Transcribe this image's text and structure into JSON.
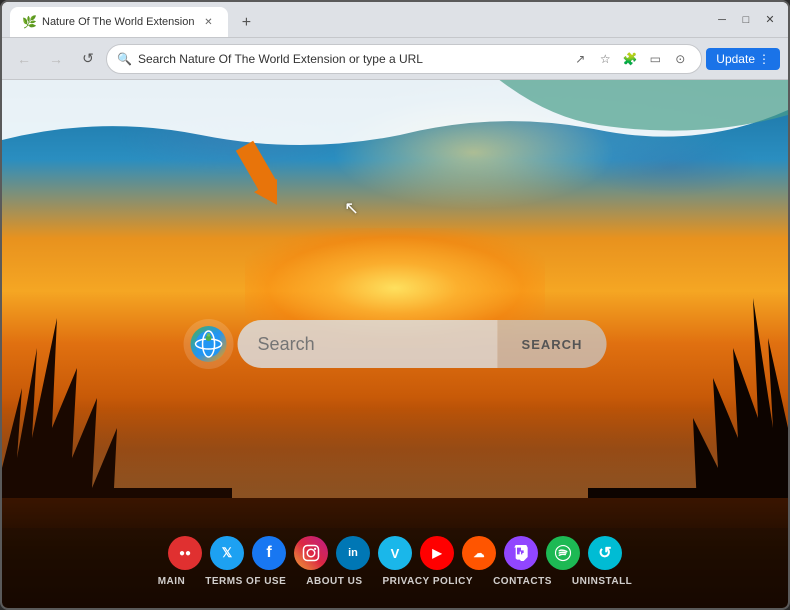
{
  "browser": {
    "tab": {
      "title": "Nature Of The World Extension",
      "favicon": "🌿"
    },
    "address_bar": {
      "url": "Search Nature Of The World Extension or type a URL",
      "placeholder": "Search Nature Of The World Extension or type a URL"
    },
    "buttons": {
      "back": "←",
      "forward": "→",
      "refresh": "↺",
      "share": "↗",
      "bookmark": "☆",
      "extensions": "🧩",
      "sidebar": "▭",
      "profile": "⊙",
      "update": "Update",
      "menu": "⋮",
      "minimize": "─",
      "maximize": "□",
      "close": "✕",
      "new_tab": "+"
    }
  },
  "page": {
    "search": {
      "placeholder": "Search",
      "button_label": "SEARCH"
    },
    "bottom_nav": {
      "links": [
        "MAIN",
        "TERMS OF USE",
        "ABOUT US",
        "PRIVACY POLICY",
        "CONTACTS",
        "UNINSTALL"
      ]
    },
    "social_icons": [
      {
        "name": "dots-icon",
        "bg": "#e03030",
        "label": "●●"
      },
      {
        "name": "twitter-icon",
        "bg": "#1da1f2",
        "label": "𝕏"
      },
      {
        "name": "facebook-icon",
        "bg": "#1877f2",
        "label": "f"
      },
      {
        "name": "instagram-icon",
        "bg": "#e1306c",
        "label": "◎"
      },
      {
        "name": "linkedin-icon",
        "bg": "#0077b5",
        "label": "in"
      },
      {
        "name": "vimeo-icon",
        "bg": "#1ab7ea",
        "label": "V"
      },
      {
        "name": "youtube-icon",
        "bg": "#ff0000",
        "label": "▶"
      },
      {
        "name": "soundcloud-icon",
        "bg": "#ff5500",
        "label": "☁"
      },
      {
        "name": "twitch-icon",
        "bg": "#9146ff",
        "label": "◻"
      },
      {
        "name": "spotify-icon",
        "bg": "#1db954",
        "label": "◎"
      },
      {
        "name": "refresh-icon",
        "bg": "#00bcd4",
        "label": "↺"
      }
    ],
    "annotation": {
      "arrow_color": "#e8740a"
    }
  }
}
